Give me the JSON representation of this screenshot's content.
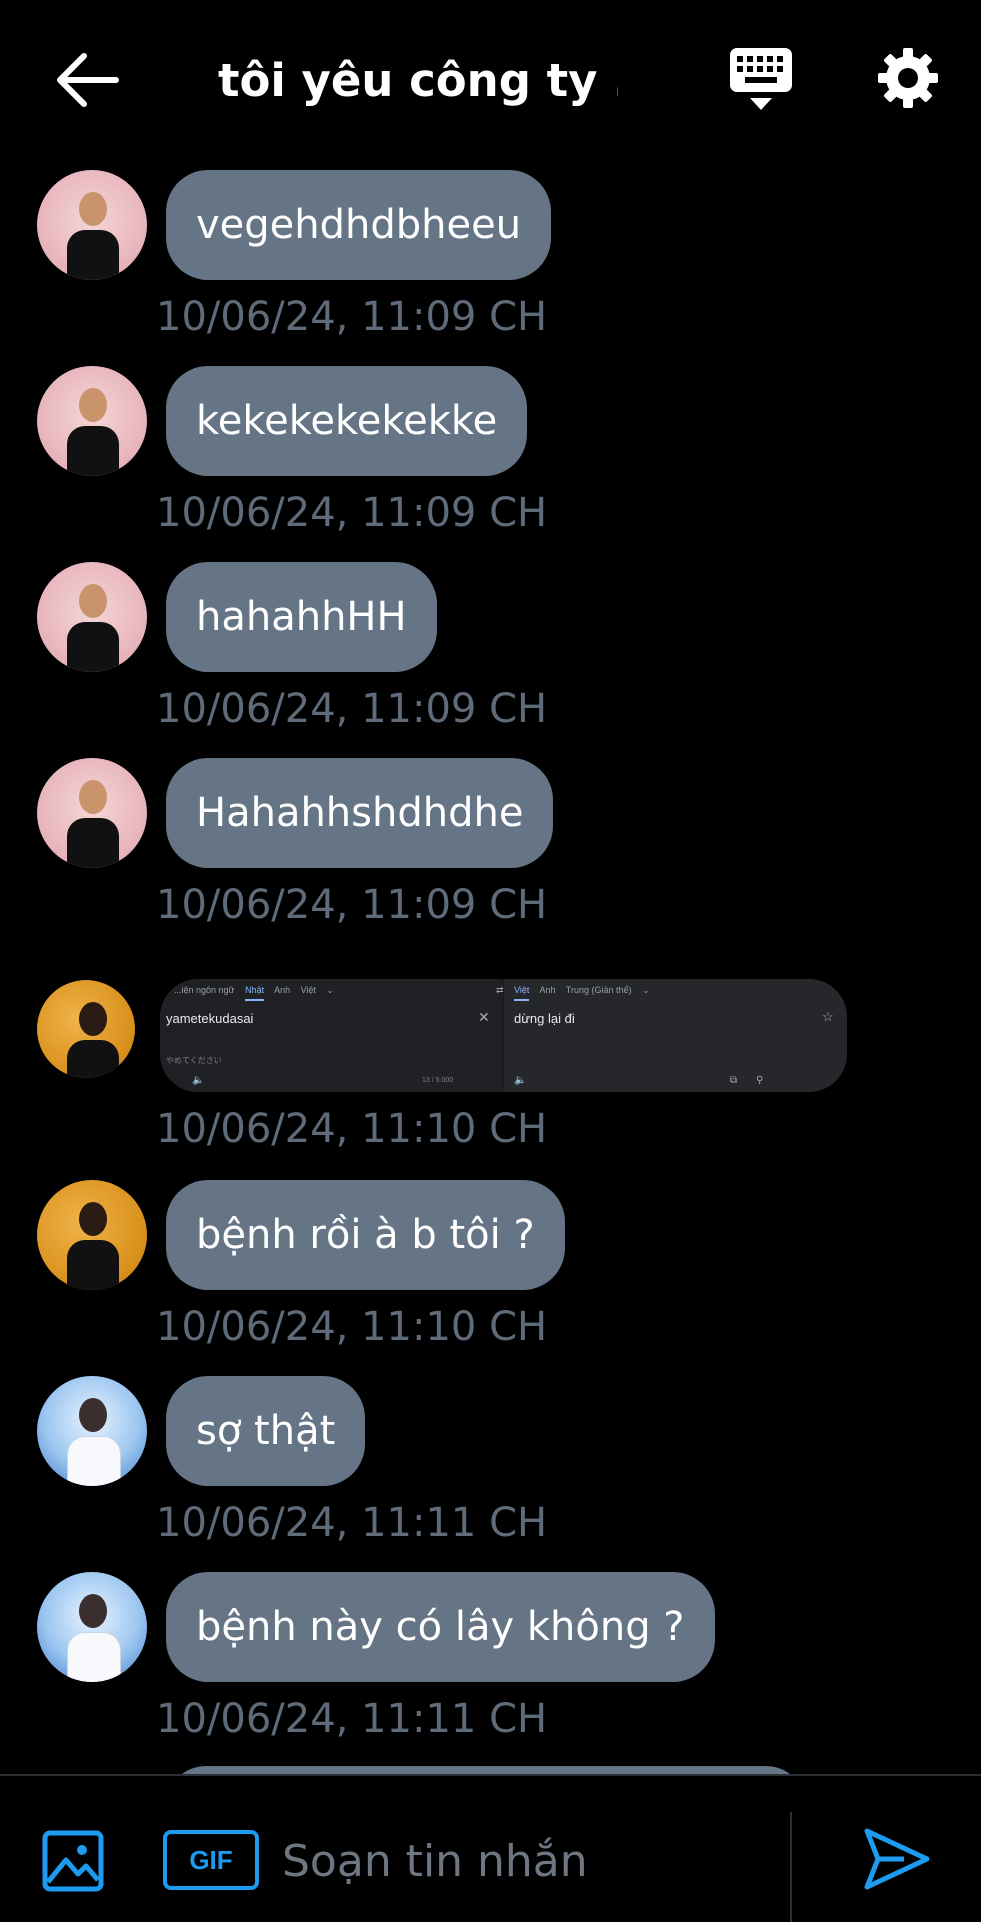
{
  "header": {
    "title": "tôi yêu công ty ...",
    "icons": [
      "arrow-left-icon",
      "keyboard-icon",
      "gear-icon"
    ]
  },
  "messages": [
    {
      "avatar": "avatar-pink",
      "text": "vegehdhdbheeu",
      "time": "10/06/24, 11:09 CH"
    },
    {
      "avatar": "avatar-pink",
      "text": "kekekekekekke",
      "time": "10/06/24, 11:09 CH"
    },
    {
      "avatar": "avatar-pink",
      "text": "hahahhHH",
      "time": "10/06/24, 11:09 CH"
    },
    {
      "avatar": "avatar-pink",
      "text": "Hahahhshdhdhe",
      "time": "10/06/24, 11:09 CH"
    },
    {
      "avatar": "avatar-orange",
      "type": "image",
      "time": "10/06/24, 11:10 CH"
    },
    {
      "avatar": "avatar-orange",
      "text": "bệnh rồi à b tôi ?",
      "time": "10/06/24, 11:10 CH"
    },
    {
      "avatar": "avatar-blue",
      "text": "sợ thật",
      "time": "10/06/24, 11:11 CH"
    },
    {
      "avatar": "avatar-blue",
      "text": "bệnh này có lây không ?",
      "time": "10/06/24, 11:11 CH"
    }
  ],
  "screenshot": {
    "left_tabs": [
      "...iện ngôn ngữ",
      "Nhật",
      "Anh",
      "Việt"
    ],
    "right_tabs": [
      "Việt",
      "Anh",
      "Trung (Giản thể)"
    ],
    "input_text": "yametekudasai",
    "kana_text": "やめてください",
    "char_count": "13 / 5.000",
    "output_text": "dừng lại đi"
  },
  "composer": {
    "placeholder": "Soạn tin nhắn",
    "gif_label": "GIF",
    "accent": "#1d9bf0"
  }
}
